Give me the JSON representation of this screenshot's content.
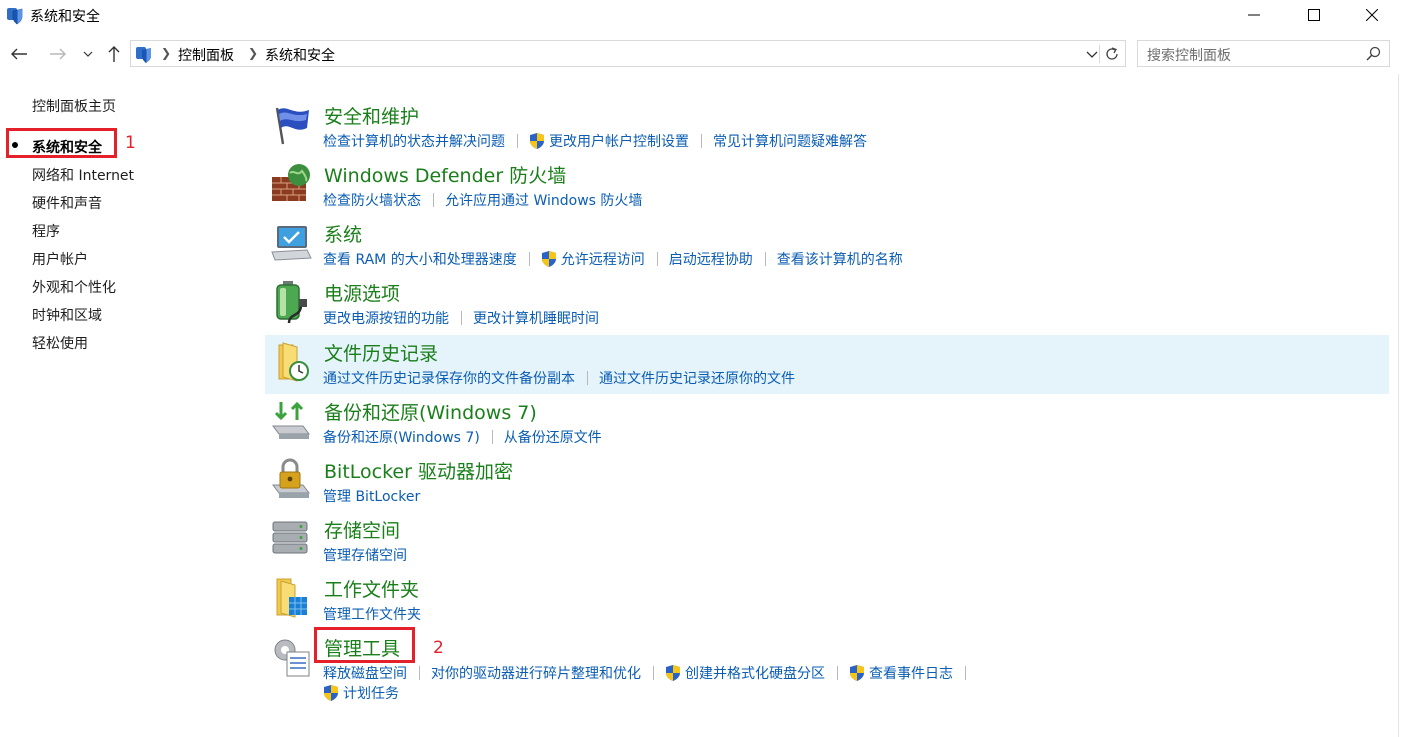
{
  "window": {
    "title": "系统和安全",
    "controls": [
      "minimize",
      "maximize",
      "close"
    ]
  },
  "navbar": {
    "back_icon": "back-arrow-icon",
    "forward_icon": "forward-arrow-icon",
    "recent_icon": "chevron-down-icon",
    "up_icon": "up-arrow-icon",
    "breadcrumbs": [
      "控制面板",
      "系统和安全"
    ],
    "search_placeholder": "搜索控制面板"
  },
  "sidebar": {
    "items": [
      {
        "label": "控制面板主页",
        "current": false
      },
      {
        "label": "系统和安全",
        "current": true
      },
      {
        "label": "网络和 Internet",
        "current": false
      },
      {
        "label": "硬件和声音",
        "current": false
      },
      {
        "label": "程序",
        "current": false
      },
      {
        "label": "用户帐户",
        "current": false
      },
      {
        "label": "外观和个性化",
        "current": false
      },
      {
        "label": "时钟和区域",
        "current": false
      },
      {
        "label": "轻松使用",
        "current": false
      }
    ]
  },
  "annotations": {
    "num1": "1",
    "num2": "2",
    "color": "#e4202a"
  },
  "categories": [
    {
      "title": "安全和维护",
      "icon": "flag-icon",
      "links": [
        {
          "label": "检查计算机的状态并解决问题",
          "shield": false
        },
        {
          "label": "更改用户帐户控制设置",
          "shield": true
        },
        {
          "label": "常见计算机问题疑难解答",
          "shield": false
        }
      ]
    },
    {
      "title": "Windows Defender 防火墙",
      "icon": "firewall-icon",
      "links": [
        {
          "label": "检查防火墙状态",
          "shield": false
        },
        {
          "label": "允许应用通过 Windows 防火墙",
          "shield": false
        }
      ]
    },
    {
      "title": "系统",
      "icon": "computer-icon",
      "links": [
        {
          "label": "查看 RAM 的大小和处理器速度",
          "shield": false
        },
        {
          "label": "允许远程访问",
          "shield": true
        },
        {
          "label": "启动远程协助",
          "shield": false
        },
        {
          "label": "查看该计算机的名称",
          "shield": false
        }
      ]
    },
    {
      "title": "电源选项",
      "icon": "battery-icon",
      "links": [
        {
          "label": "更改电源按钮的功能",
          "shield": false
        },
        {
          "label": "更改计算机睡眠时间",
          "shield": false
        }
      ]
    },
    {
      "title": "文件历史记录",
      "icon": "file-history-icon",
      "links": [
        {
          "label": "通过文件历史记录保存你的文件备份副本",
          "shield": false
        },
        {
          "label": "通过文件历史记录还原你的文件",
          "shield": false
        }
      ]
    },
    {
      "title": "备份和还原(Windows 7)",
      "icon": "backup-icon",
      "links": [
        {
          "label": "备份和还原(Windows 7)",
          "shield": false
        },
        {
          "label": "从备份还原文件",
          "shield": false
        }
      ]
    },
    {
      "title": "BitLocker 驱动器加密",
      "icon": "bitlocker-icon",
      "links": [
        {
          "label": "管理 BitLocker",
          "shield": false
        }
      ]
    },
    {
      "title": "存储空间",
      "icon": "storage-icon",
      "links": [
        {
          "label": "管理存储空间",
          "shield": false
        }
      ]
    },
    {
      "title": "工作文件夹",
      "icon": "work-folders-icon",
      "links": [
        {
          "label": "管理工作文件夹",
          "shield": false
        }
      ]
    },
    {
      "title": "管理工具",
      "icon": "admin-tools-icon",
      "links": [
        {
          "label": "释放磁盘空间",
          "shield": false
        },
        {
          "label": "对你的驱动器进行碎片整理和优化",
          "shield": false
        },
        {
          "label": "创建并格式化硬盘分区",
          "shield": true
        },
        {
          "label": "查看事件日志",
          "shield": true
        }
      ],
      "links2": [
        {
          "label": "计划任务",
          "shield": true
        }
      ]
    }
  ]
}
